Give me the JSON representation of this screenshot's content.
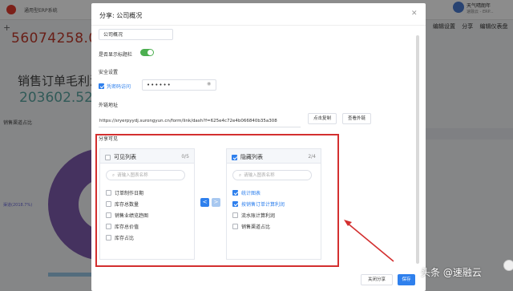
{
  "background_app": {
    "app_title": "通用型ERP系统",
    "user_name": "天气晴朗年",
    "user_sub": "速融云 - ERP...",
    "toolbar": [
      "编辑设置",
      "分享",
      "编辑仪表盘"
    ],
    "big_number_1": "56074258.0",
    "chart_title": "销售订单毛利润",
    "big_number_2": "203602.52",
    "chart3_title": "销售渠道占比",
    "donut_label": "渠道(2018.7%)"
  },
  "modal": {
    "title": "分享: 公司概况",
    "close_icon": "close-icon",
    "title_input_value": "公司概况",
    "show_title_label": "是否显示标题栏",
    "show_title_on": true,
    "security_label": "安全设置",
    "password_check_label": "凭密码访问",
    "password_checked": true,
    "password_value": "••••••",
    "link_label": "外链地址",
    "link_value": "https://sryerpyydj.surongyun.cn/form/link/dash?f=625e4c72e4b066840b35a308",
    "copy_button": "点击复制",
    "view_button": "查看外链",
    "visible_label": "分享可见",
    "visible_list": {
      "title": "可见列表",
      "count": "0/5",
      "search_placeholder": "请输入图表名称",
      "items": [
        "订单制作日期",
        "库存总数量",
        "销售业绩览趋图",
        "库存总价值",
        "库存占比"
      ]
    },
    "hidden_list": {
      "title": "隐藏列表",
      "count": "2/4",
      "search_placeholder": "请输入图表名称",
      "items": [
        {
          "label": "统计图表",
          "checked": true
        },
        {
          "label": "按销售订单计算利润",
          "checked": true
        },
        {
          "label": "流水账计算利润",
          "checked": false
        },
        {
          "label": "销售渠道占比",
          "checked": false
        }
      ]
    },
    "transfer_left": "<",
    "transfer_right": ">",
    "close_share_button": "关闭分享",
    "save_button": "保存"
  },
  "colors": {
    "primary": "#2f80ed",
    "toggle_on": "#4caf50",
    "annotation": "#d32f2f"
  },
  "watermark": "头条 @速融云"
}
